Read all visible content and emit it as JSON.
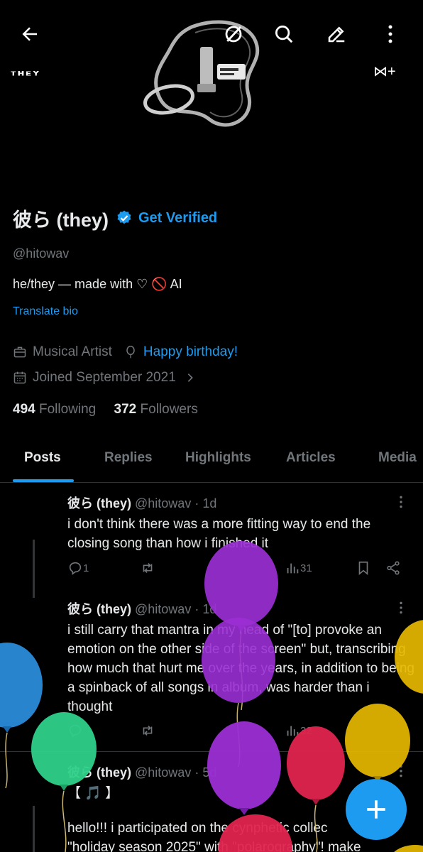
{
  "banner": {
    "logo_left": "ᴛʜᴇʏ",
    "logo_right": "⋈+"
  },
  "topbar": {
    "back_icon": "arrow-left-icon",
    "grok_icon": "slash-circle-icon",
    "search_icon": "search-icon",
    "edit_icon": "pencil-icon",
    "more_icon": "more-vertical-icon"
  },
  "profile": {
    "display_name": "彼ら (they)",
    "get_verified": "Get Verified",
    "handle": "@hitowav",
    "bio": "he/they — made with ♡ 🚫 AI",
    "translate": "Translate bio",
    "category": "Musical Artist",
    "birthday": "Happy birthday!",
    "joined": "Joined September 2021",
    "following_count": "494",
    "following_label": "Following",
    "followers_count": "372",
    "followers_label": "Followers"
  },
  "tabs": [
    "Posts",
    "Replies",
    "Highlights",
    "Articles",
    "Media"
  ],
  "posts": [
    {
      "name": "彼ら (they)",
      "meta": "@hitowav · 1d",
      "text": "i don't think there was a more fitting way to end the closing song than how i finished it",
      "replies": "1",
      "views": "31"
    },
    {
      "name": "彼ら (they)",
      "meta": "@hitowav · 1d",
      "text": "i still carry that mantra in my head of \"[to] provoke an emotion on the other side of the screen\" but, transcribing how much that hurt me over the years, in addition to being a spinback of all songs in album, was harder than i thought",
      "views": "32"
    },
    {
      "name": "彼ら (they)",
      "meta": "@hitowav · 5d",
      "text_line1": "【 🎵 】",
      "text_line2": "hello!!! i participated on the cynphetic collec",
      "text_line3": "\"holiday season 2025\" with \"polarography\"! make"
    }
  ],
  "colors": {
    "accent": "#1d9bf0",
    "muted": "#71767b",
    "text": "#e7e9ea",
    "balloon_purple": "#9b2fd4",
    "balloon_blue": "#2c8fe0",
    "balloon_green": "#2fd08a",
    "balloon_yellow": "#e6b800",
    "balloon_red": "#e0244f"
  }
}
